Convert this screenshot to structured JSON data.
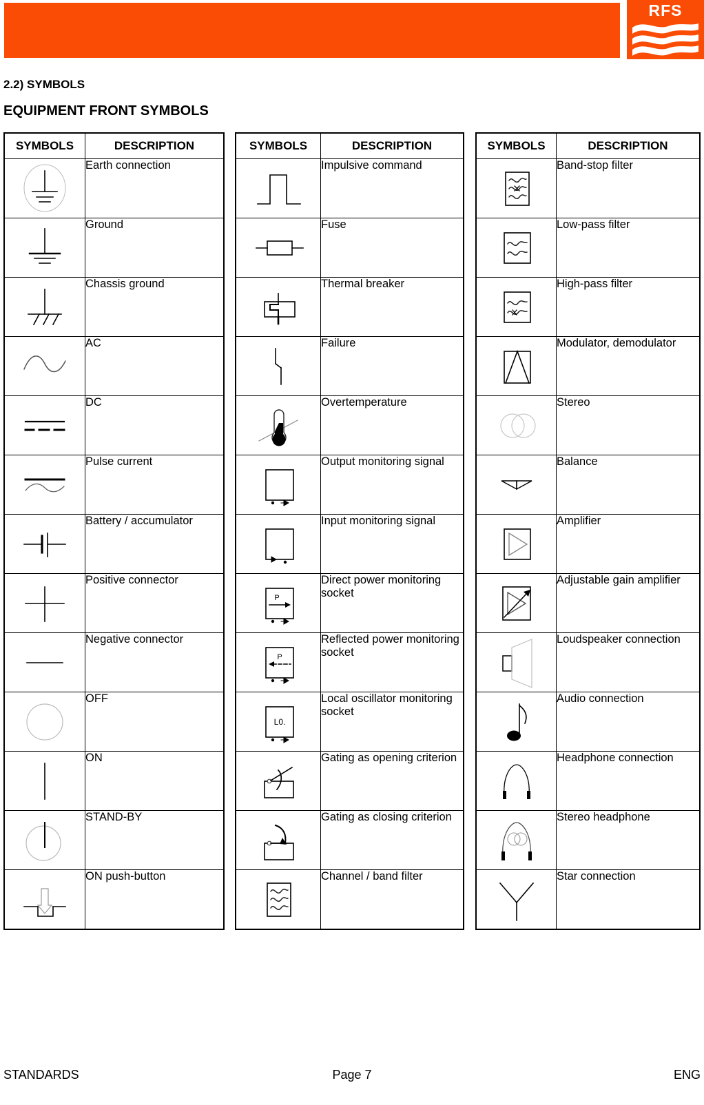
{
  "header": {
    "brand": "RFS",
    "brand_color": "#fb4c06",
    "wave_color": "#ffffff"
  },
  "titles": {
    "section_number": "2.2) SYMBOLS",
    "section_heading": "EQUIPMENT FRONT SYMBOLS"
  },
  "table_headers": {
    "symbols": "SYMBOLS",
    "description": "DESCRIPTION"
  },
  "tables": [
    {
      "rows": [
        {
          "icon": "earth-connection-symbol",
          "description": "Earth connection"
        },
        {
          "icon": "ground-symbol",
          "description": "Ground"
        },
        {
          "icon": "chassis-ground-symbol",
          "description": "Chassis ground"
        },
        {
          "icon": "ac-symbol",
          "description": "AC"
        },
        {
          "icon": "dc-symbol",
          "description": "DC"
        },
        {
          "icon": "pulse-current-symbol",
          "description": "Pulse current"
        },
        {
          "icon": "battery-symbol",
          "description": "Battery / accumulator"
        },
        {
          "icon": "positive-connector-symbol",
          "description": "Positive connector"
        },
        {
          "icon": "negative-connector-symbol",
          "description": "Negative connector"
        },
        {
          "icon": "off-symbol",
          "description": "OFF"
        },
        {
          "icon": "on-symbol",
          "description": "ON"
        },
        {
          "icon": "stand-by-symbol",
          "description": "STAND-BY"
        },
        {
          "icon": "on-push-button-symbol",
          "description": "ON push-button"
        }
      ]
    },
    {
      "rows": [
        {
          "icon": "impulsive-command-symbol",
          "description": "Impulsive command"
        },
        {
          "icon": "fuse-symbol",
          "description": "Fuse"
        },
        {
          "icon": "thermal-breaker-symbol",
          "description": "Thermal breaker"
        },
        {
          "icon": "failure-symbol",
          "description": "Failure"
        },
        {
          "icon": "overtemperature-symbol",
          "description": "Overtemperature"
        },
        {
          "icon": "output-monitoring-signal-symbol",
          "description": "Output monitoring signal"
        },
        {
          "icon": "input-monitoring-signal-symbol",
          "description": "Input monitoring signal"
        },
        {
          "icon": "direct-power-socket-symbol",
          "description": "Direct power monitoring socket",
          "label": "P"
        },
        {
          "icon": "reflected-power-socket-symbol",
          "description": "Reflected power monitoring socket",
          "label": "P"
        },
        {
          "icon": "local-oscillator-socket-symbol",
          "description": "Local oscillator monitoring socket",
          "label": "L0."
        },
        {
          "icon": "gating-opening-symbol",
          "description": "Gating as opening criterion"
        },
        {
          "icon": "gating-closing-symbol",
          "description": "Gating as closing criterion"
        },
        {
          "icon": "channel-band-filter-symbol",
          "description": "Channel / band filter"
        }
      ]
    },
    {
      "rows": [
        {
          "icon": "band-stop-filter-symbol",
          "description": "Band-stop filter"
        },
        {
          "icon": "low-pass-filter-symbol",
          "description": "Low-pass filter"
        },
        {
          "icon": "high-pass-filter-symbol",
          "description": "High-pass filter"
        },
        {
          "icon": "modulator-symbol",
          "description": "Modulator, demodulator"
        },
        {
          "icon": "stereo-symbol",
          "description": "Stereo"
        },
        {
          "icon": "balance-symbol",
          "description": "Balance"
        },
        {
          "icon": "amplifier-symbol",
          "description": "Amplifier"
        },
        {
          "icon": "adjustable-gain-amplifier-symbol",
          "description": "Adjustable gain amplifier"
        },
        {
          "icon": "loudspeaker-symbol",
          "description": "Loudspeaker connection"
        },
        {
          "icon": "audio-connection-symbol",
          "description": "Audio connection"
        },
        {
          "icon": "headphone-symbol",
          "description": "Headphone connection"
        },
        {
          "icon": "stereo-headphone-symbol",
          "description": "Stereo headphone"
        },
        {
          "icon": "star-connection-symbol",
          "description": "Star connection"
        }
      ]
    }
  ],
  "footer": {
    "left": "STANDARDS",
    "center": "Page 7",
    "right": "ENG"
  }
}
